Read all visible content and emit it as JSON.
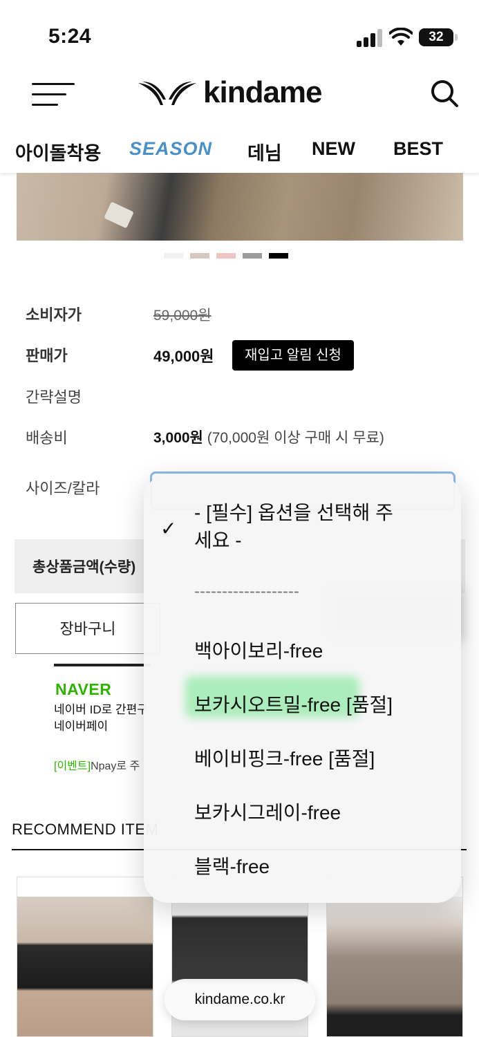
{
  "status_bar": {
    "time": "5:24",
    "battery": "32"
  },
  "header": {
    "logo_text": "kindame"
  },
  "categories": [
    "아이돌착용",
    "SEASON",
    "데님",
    "NEW",
    "BEST"
  ],
  "product": {
    "swatch_colors": [
      "#f2f2f2",
      "#d6c8bc",
      "#efc4c2",
      "#9b9b9b",
      "#000000"
    ],
    "consumer_price_label": "소비자가",
    "consumer_price": "59,000원",
    "sale_price_label": "판매가",
    "sale_price": "49,000원",
    "restock_button": "재입고 알림 신청",
    "summary_label": "간략설명",
    "shipping_label": "배송비",
    "shipping_fee": "3,000원",
    "shipping_note": "(70,000원 이상 구매 시 무료)",
    "option_label": "사이즈/칼라"
  },
  "total": {
    "label": "총상품금액(수량)"
  },
  "buttons": {
    "cart": "장바구니"
  },
  "naver": {
    "logo": "NAVER",
    "desc_line1": "네이버 ID로 간편구",
    "desc_line2": "네이버페이",
    "event_tag": "[이벤트]",
    "event_text": "Npay로 주"
  },
  "recommend": {
    "title": "RECOMMEND ITEM"
  },
  "dropdown": {
    "options": [
      "- [필수] 옵션을 선택해 주세요 -",
      "-------------------",
      "백아이보리-free",
      "보카시오트밀-free [품절]",
      "베이비핑크-free [품절]",
      "보카시그레이-free",
      "블랙-free"
    ],
    "selected_index": 0,
    "check_mark": "✓"
  },
  "browser": {
    "url": "kindame.co.kr"
  }
}
